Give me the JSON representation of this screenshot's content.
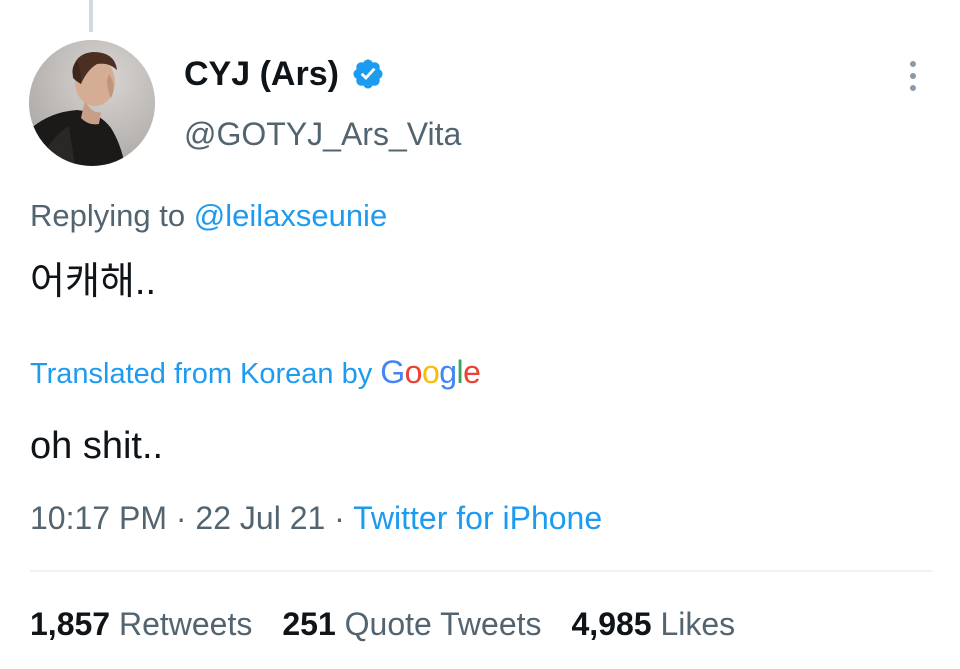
{
  "tweet": {
    "author": {
      "display_name": "CYJ (Ars)",
      "handle": "@GOTYJ_Ars_Vita",
      "verified": true,
      "avatar_icon": "user-avatar-photo"
    },
    "replying_prefix": "Replying to",
    "replying_to": "@leilaxseunie",
    "text": "어캐해..",
    "translation": {
      "label": "Translated from Korean by",
      "provider_letters": [
        "G",
        "o",
        "o",
        "g",
        "l",
        "e"
      ],
      "provider_colors": [
        "#4285F4",
        "#EA4335",
        "#FBBC05",
        "#4285F4",
        "#34A853",
        "#EA4335"
      ],
      "text": "oh shit.."
    },
    "time": "10:17 PM",
    "date": "22 Jul 21",
    "separator": " · ",
    "source": "Twitter for iPhone",
    "stats": {
      "retweets_count": "1,857",
      "retweets_label": "Retweets",
      "quotes_count": "251",
      "quotes_label": "Quote Tweets",
      "likes_count": "4,985",
      "likes_label": "Likes"
    }
  },
  "colors": {
    "link": "#1d9bf0",
    "secondary_text": "#536471",
    "primary_text": "#0f1419",
    "verified_badge": "#1d9bf0"
  },
  "icons": [
    "verified-badge-icon",
    "more-options-icon"
  ]
}
